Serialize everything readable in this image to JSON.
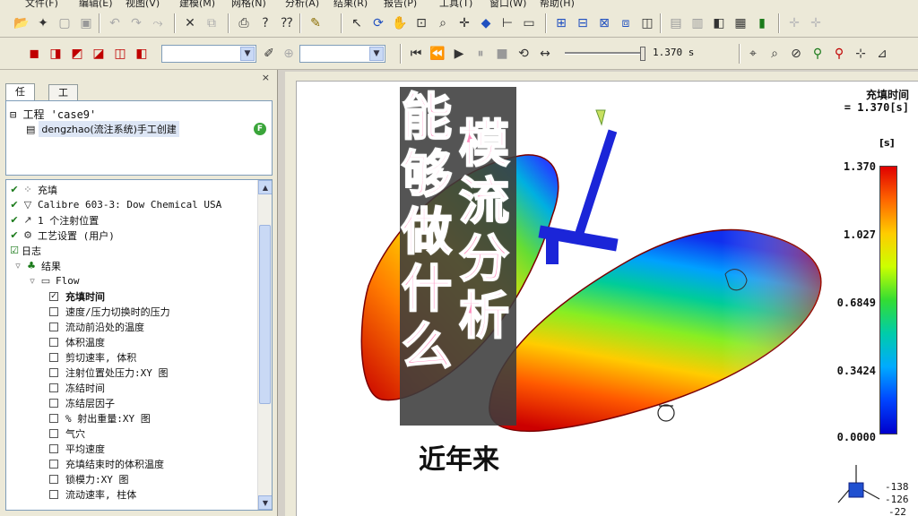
{
  "menu": [
    "文件(F)",
    "编辑(E)",
    "视图(V)",
    "建模(M)",
    "网格(N)",
    "分析(A)",
    "结果(R)",
    "报告(P)",
    "工具(T)",
    "窗口(W)",
    "帮助(H)"
  ],
  "toolbar": {
    "time_readout": "1.370 s"
  },
  "panel": {
    "close": "×",
    "tabs": [
      "任务",
      "工具"
    ],
    "project_root": "工程 'case9'",
    "study_label": "dengzhao(流注系统)手工创建",
    "study_badge": "F"
  },
  "tasks": [
    {
      "text": "充填",
      "type": "step",
      "check": "✔",
      "icon": "fill-icon"
    },
    {
      "text": "Calibre 603-3: Dow Chemical USA",
      "type": "step",
      "check": "✔",
      "icon": "material-icon"
    },
    {
      "text": "1 个注射位置",
      "type": "step",
      "check": "✔",
      "icon": "injection-icon"
    },
    {
      "text": "工艺设置 (用户)",
      "type": "step",
      "check": "✔",
      "icon": "process-icon"
    },
    {
      "text": "日志",
      "type": "log",
      "check": "☑",
      "icon": ""
    },
    {
      "text": "结果",
      "type": "group",
      "check": "",
      "icon": "results-icon"
    },
    {
      "text": "Flow",
      "type": "folder",
      "check": "",
      "icon": "folder-icon"
    },
    {
      "text": "充填时间",
      "type": "result",
      "checked": true
    },
    {
      "text": "速度/压力切换时的压力",
      "type": "result",
      "checked": false
    },
    {
      "text": "流动前沿处的温度",
      "type": "result",
      "checked": false
    },
    {
      "text": "体积温度",
      "type": "result",
      "checked": false
    },
    {
      "text": "剪切速率, 体积",
      "type": "result",
      "checked": false
    },
    {
      "text": "注射位置处压力:XY 图",
      "type": "result",
      "checked": false
    },
    {
      "text": "冻结时间",
      "type": "result",
      "checked": false
    },
    {
      "text": "冻结层因子",
      "type": "result",
      "checked": false
    },
    {
      "text": "% 射出重量:XY 图",
      "type": "result",
      "checked": false
    },
    {
      "text": "气穴",
      "type": "result",
      "checked": false
    },
    {
      "text": "平均速度",
      "type": "result",
      "checked": false
    },
    {
      "text": "充填结束时的体积温度",
      "type": "result",
      "checked": false
    },
    {
      "text": "锁模力:XY 图",
      "type": "result",
      "checked": false
    },
    {
      "text": "流动速率, 柱体",
      "type": "result",
      "checked": false
    }
  ],
  "legend": {
    "title": "充填时间",
    "time": "= 1.370[s]",
    "unit": "[s]",
    "ticks": [
      "1.370",
      "1.027",
      "0.6849",
      "0.3424",
      "0.0000"
    ],
    "colors": [
      "#e00000",
      "#ffcc00",
      "#33dd33",
      "#00aaff",
      "#0000cc"
    ]
  },
  "axis": [
    "-138",
    "-126",
    "-22"
  ],
  "overlay": {
    "left": [
      "能",
      "够",
      "做",
      "什",
      "么"
    ],
    "right": [
      "模",
      "流",
      "分",
      "析"
    ],
    "subtitle": "近年来",
    "color": "#ff8fc0"
  }
}
